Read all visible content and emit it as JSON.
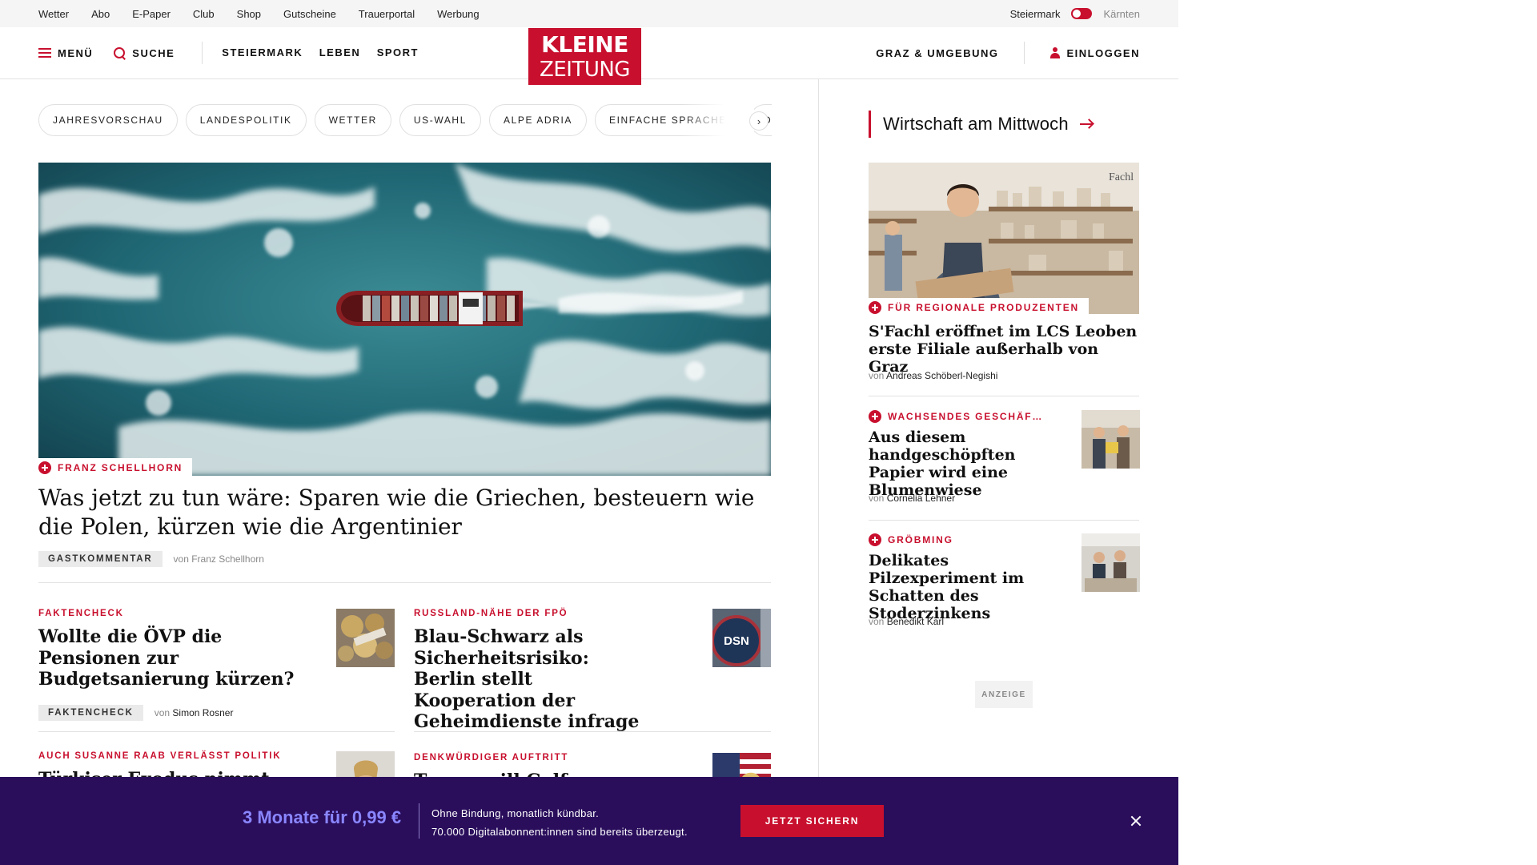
{
  "utility_nav": {
    "links": [
      "Wetter",
      "Abo",
      "E-Paper",
      "Club",
      "Shop",
      "Gutscheine",
      "Trauerportal",
      "Werbung"
    ],
    "region_active": "Steiermark",
    "region_inactive": "Kärnten"
  },
  "header": {
    "menu_label": "MENÜ",
    "search_label": "SUCHE",
    "nav": [
      "STEIERMARK",
      "LEBEN",
      "SPORT"
    ],
    "logo_line1": "KLEINE",
    "logo_line2": "ZEITUNG",
    "region_label": "GRAZ & UMGEBUNG",
    "login_label": "EINLOGGEN"
  },
  "topic_pills": [
    "JAHRESVORSCHAU",
    "LANDESPOLITIK",
    "WETTER",
    "US-WAHL",
    "ALPE ADRIA",
    "EINFACHE SPRACHE",
    "DOS"
  ],
  "hero": {
    "kicker": "FRANZ SCHELLHORN",
    "title": "Was jetzt zu tun wäre: Sparen wie die Griechen, besteuern wie die Polen, kürzen wie die Argentinier",
    "tag": "GASTKOMMENTAR",
    "by_prefix": "von",
    "author": "Franz Schellhorn"
  },
  "articles": [
    {
      "kicker": "FAKTENCHECK",
      "title": "Wollte die ÖVP die Pensionen zur Budgetsanierung kürzen?",
      "tag": "FAKTENCHECK",
      "by_prefix": "von",
      "author": "Simon Rosner"
    },
    {
      "kicker": "RUSSLAND-NÄHE DER FPÖ",
      "title": "Blau-Schwarz als Sicherheitsrisiko: Berlin stellt Kooperation der Geheimdienste infrage",
      "thumb_text": "DSN"
    },
    {
      "kicker": "AUCH SUSANNE RAAB VERLÄSST POLITIK",
      "title": "Türkiser Exodus nimmt Fahrt auf"
    },
    {
      "kicker": "DENKWÜRDIGER AUFTRITT",
      "title": "Trump will Golf"
    }
  ],
  "sidebar": {
    "heading": "Wirtschaft am Mittwoch",
    "feature": {
      "kicker": "FÜR REGIONALE PRODUZENTEN",
      "title": "S'Fachl eröffnet im LCS Leoben erste Filiale außerhalb von Graz",
      "by_prefix": "von",
      "author": "Andreas Schöberl-Negishi",
      "sign_text": "Fachl"
    },
    "items": [
      {
        "kicker": "WACHSENDES GESCHÄF…",
        "title": "Aus diesem handgeschöpften Papier wird eine Blumenwiese",
        "by_prefix": "von",
        "author": "Cornelia Lehner"
      },
      {
        "kicker": "GRÖBMING",
        "title": "Delikates Pilzexperiment im Schatten des Stoderzinkens",
        "by_prefix": "von",
        "author": "Benedikt Karl"
      }
    ],
    "ad_label": "ANZEIGE"
  },
  "promo": {
    "price": "3 Monate für 0,99 €",
    "line1": "Ohne Bindung, monatlich kündbar.",
    "line2": "70.000 Digitalabonnent:innen sind bereits überzeugt.",
    "button": "JETZT SICHERN"
  },
  "colors": {
    "brand_red": "#c8102e",
    "promo_bg": "#2a0e5c",
    "promo_price": "#8a86ff"
  }
}
